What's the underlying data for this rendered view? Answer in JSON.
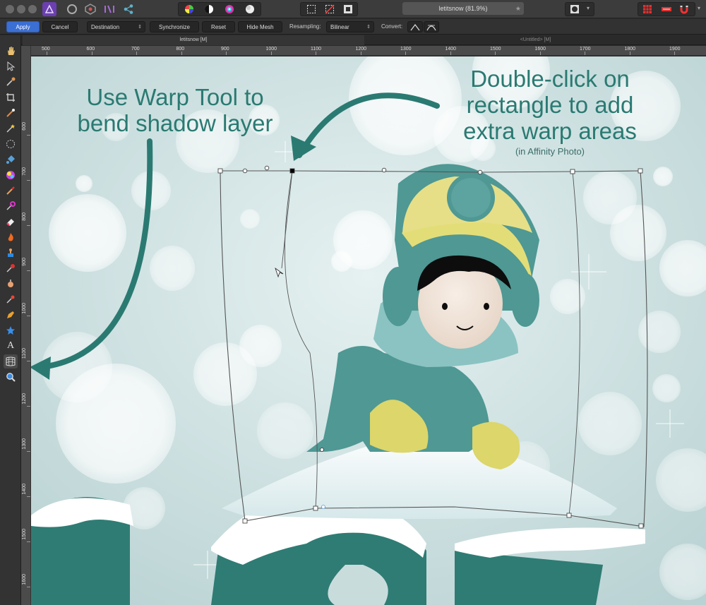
{
  "app": {
    "document_title": "letitsnow (81.9%)",
    "star_icon": "star-icon"
  },
  "context_toolbar": {
    "apply_label": "Apply",
    "cancel_label": "Cancel",
    "source_value": "Destination",
    "synchronize_label": "Synchronize",
    "reset_label": "Reset",
    "hide_mesh_label": "Hide Mesh",
    "resampling_label": "Resampling:",
    "resampling_value": "Bilinear",
    "convert_label": "Convert:"
  },
  "tabs": {
    "active": "letitsnow [M]",
    "inactive": "<Untitled> [M]"
  },
  "rulers": {
    "unit": "px",
    "horizontal": [
      "500",
      "600",
      "700",
      "800",
      "900",
      "1000",
      "1100",
      "1200",
      "1300",
      "1400",
      "1500",
      "1600",
      "1700",
      "1800",
      "1900"
    ],
    "vertical": [
      "600",
      "700",
      "800",
      "900",
      "1000",
      "1100",
      "1200",
      "1300",
      "1400",
      "1500",
      "1600"
    ]
  },
  "annotations": {
    "left_line1": "Use Warp Tool to",
    "left_line2": "bend shadow layer",
    "right_line1": "Double-click on",
    "right_line2": "rectangle to add",
    "right_line3": "extra warp areas",
    "right_note": "(in Affinity Photo)"
  },
  "colors": {
    "accent_teal": "#2a7a72",
    "apply_blue": "#3b6fd4",
    "canvas_bg": "#c9dcdc"
  }
}
